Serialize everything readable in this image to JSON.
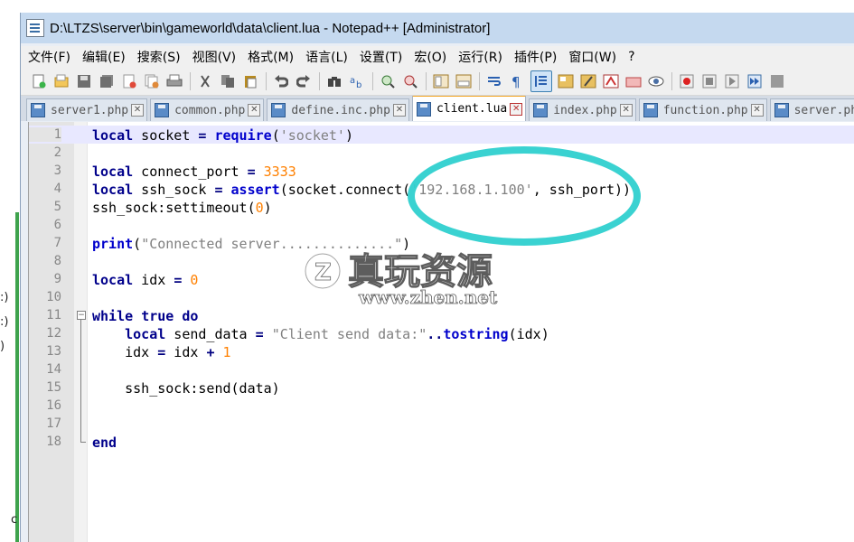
{
  "desktop": {
    "fragments": [
      ":)",
      ":)",
      ")",
      "c"
    ]
  },
  "window": {
    "title": "D:\\LTZS\\server\\bin\\gameworld\\data\\client.lua - Notepad++ [Administrator]"
  },
  "menu": {
    "items": [
      "文件(F)",
      "编辑(E)",
      "搜索(S)",
      "视图(V)",
      "格式(M)",
      "语言(L)",
      "设置(T)",
      "宏(O)",
      "运行(R)",
      "插件(P)",
      "窗口(W)",
      "?"
    ]
  },
  "toolbar": {
    "buttons": [
      "new-file-icon",
      "open-file-icon",
      "save-icon",
      "save-all-icon",
      "close-icon",
      "close-all-icon",
      "print-icon",
      "cut-icon",
      "copy-icon",
      "paste-icon",
      "undo-icon",
      "redo-icon",
      "find-icon",
      "replace-icon",
      "zoom-in-icon",
      "zoom-out-icon",
      "sync-vertical-icon",
      "sync-horizontal-icon",
      "word-wrap-icon",
      "show-all-chars-icon",
      "indent-guide-icon",
      "doc-map-icon",
      "function-list-icon",
      "folder-workspace-icon",
      "monitor-icon",
      "view-icon",
      "record-macro-icon",
      "stop-macro-icon",
      "play-macro-icon",
      "run-macro-multiple-icon",
      "save-macro-icon"
    ]
  },
  "tabs": [
    {
      "label": "server1.php",
      "active": false
    },
    {
      "label": "common.php",
      "active": false
    },
    {
      "label": "define.inc.php",
      "active": false
    },
    {
      "label": "client.lua",
      "active": true
    },
    {
      "label": "index.php",
      "active": false
    },
    {
      "label": "function.php",
      "active": false
    },
    {
      "label": "server.ph",
      "active": false
    }
  ],
  "editor": {
    "current_line": 1,
    "lines": [
      {
        "n": "1"
      },
      {
        "n": "2"
      },
      {
        "n": "3"
      },
      {
        "n": "4"
      },
      {
        "n": "5"
      },
      {
        "n": "6"
      },
      {
        "n": "7"
      },
      {
        "n": "8"
      },
      {
        "n": "9"
      },
      {
        "n": "10"
      },
      {
        "n": "11"
      },
      {
        "n": "12"
      },
      {
        "n": "13"
      },
      {
        "n": "14"
      },
      {
        "n": "15"
      },
      {
        "n": "16"
      },
      {
        "n": "17"
      },
      {
        "n": "18"
      }
    ],
    "code": {
      "l1": {
        "kw": "local",
        "name": " socket ",
        "eq": "=",
        "fn": "require",
        "open": "(",
        "str": "'socket'",
        "close": ")"
      },
      "l3": {
        "kw": "local",
        "name": " connect_port ",
        "eq": "=",
        "num": "3333"
      },
      "l4": {
        "kw": "local",
        "name": " ssh_sock ",
        "eq": "=",
        "fn": "assert",
        "mid": "(socket.connect(",
        "str": "'192.168.1.100'",
        "rest": ", ssh_port))"
      },
      "l5": {
        "pre": "ssh_sock:settimeout(",
        "num": "0",
        "post": ")"
      },
      "l7": {
        "fn": "print",
        "open": "(",
        "str": "\"Connected server..............\"",
        "close": ")"
      },
      "l9": {
        "kw": "local",
        "name": " idx ",
        "eq": "=",
        "num": "0"
      },
      "l11": {
        "kw1": "while",
        "kw2": "true",
        "kw3": "do"
      },
      "l12": {
        "kw": "local",
        "name": " send_data ",
        "eq": "=",
        "str": "\"Client send data:\"",
        "dots": "..",
        "fn": "tostring",
        "rest": "(idx)"
      },
      "l13": {
        "pre": "idx ",
        "eq": "=",
        "mid": " idx ",
        "plus": "+",
        "num": "1"
      },
      "l15": {
        "pre": "ssh_sock:send(data)"
      },
      "l18": {
        "kw": "end"
      }
    }
  },
  "overlay": {
    "watermark_title": "真玩资源",
    "watermark_url": "www.zhen.net",
    "colors": {
      "ellipse": "#2fd0cf",
      "watermark": "#ffffff"
    }
  }
}
